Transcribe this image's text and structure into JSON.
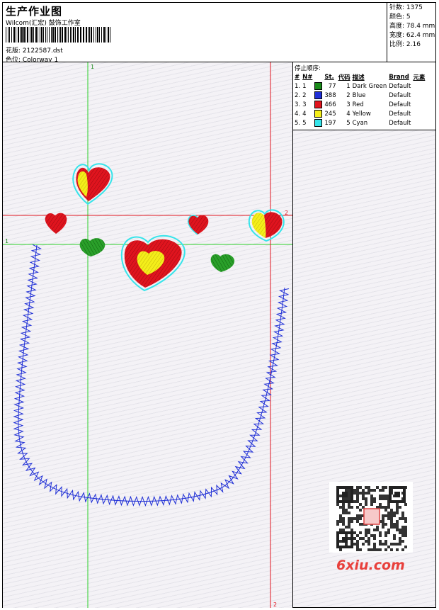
{
  "header": {
    "title": "生产作业图",
    "company": "Wilcom(汇宏) 鼓饰工作室",
    "design_label": "花版: 2122587.dst",
    "colorway_label": "色位: Colorway 1"
  },
  "stats": {
    "stitches": "针数: 1375",
    "colors": "颜色: 5",
    "height": "高度: 78.4 mm",
    "width": "宽度: 62.4 mm",
    "scale": "比例: 2.16"
  },
  "stop_sequence": {
    "heading": "停止顺序:",
    "columns": [
      "#",
      "N#",
      "St.",
      "代码",
      "描述",
      "Brand",
      "元素"
    ],
    "rows": [
      {
        "idx": "1.",
        "n": "1",
        "color": "#1a8a1a",
        "st": "77",
        "code": "1",
        "desc": "Dark Green",
        "brand": "Default"
      },
      {
        "idx": "2.",
        "n": "2",
        "color": "#1f2fd6",
        "st": "388",
        "code": "2",
        "desc": "Blue",
        "brand": "Default"
      },
      {
        "idx": "3.",
        "n": "3",
        "color": "#e0141e",
        "st": "466",
        "code": "3",
        "desc": "Red",
        "brand": "Default"
      },
      {
        "idx": "4.",
        "n": "4",
        "color": "#f4ee1a",
        "st": "245",
        "code": "4",
        "desc": "Yellow",
        "brand": "Default"
      },
      {
        "idx": "5.",
        "n": "5",
        "color": "#36e4ea",
        "st": "197",
        "code": "5",
        "desc": "Cyan",
        "brand": "Default"
      }
    ]
  },
  "guides": {
    "green_label_top": "1",
    "green_label_left": "1",
    "red_label_right": "2",
    "red_label_bottom": "2"
  },
  "watermark": "6xiu.com",
  "colors": {
    "green": "#1a8a1a",
    "blue": "#1f2fd6",
    "red": "#e0141e",
    "yellow": "#f4ee1a",
    "cyan": "#36e4ea",
    "guide_green": "#2bd02b",
    "guide_red": "#e0141e"
  }
}
